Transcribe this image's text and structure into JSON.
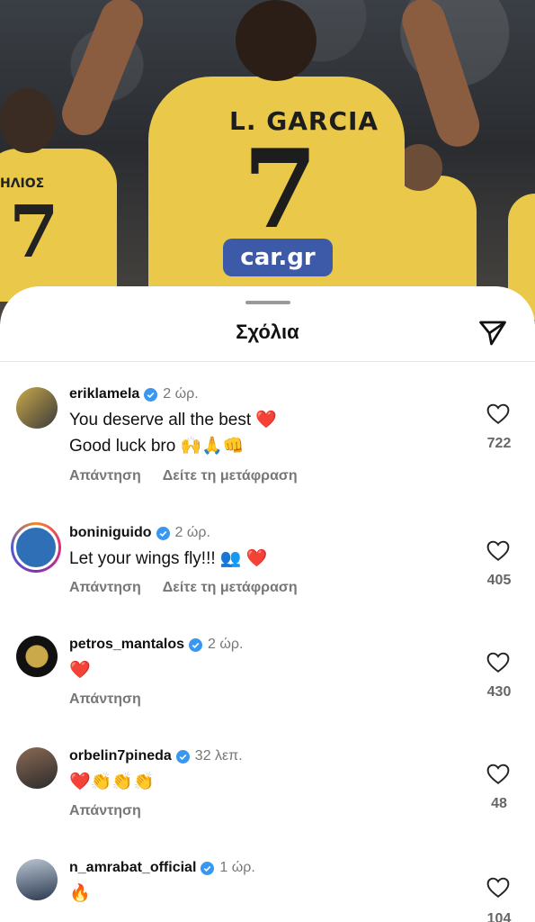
{
  "photo": {
    "shirt_name": "L. GARCIA",
    "shirt_number": "7",
    "left_shirt_name": "ΗΛΙΟΣ",
    "left_shirt_number": "7",
    "sponsor": "car.gr"
  },
  "sheet": {
    "title": "Σχόλια"
  },
  "colors": {
    "verified": "#3897f0",
    "heart": "#ed4956",
    "muted": "#777777"
  },
  "comments": [
    {
      "username": "eriklamela",
      "time": "2 ώρ.",
      "lines": [
        "You deserve all the best ❤️",
        "Good luck bro 🙌🙏👊"
      ],
      "reply_label": "Απάντηση",
      "translate_label": "Δείτε τη μετάφραση",
      "likes": "722"
    },
    {
      "username": "boniniguido",
      "time": "2 ώρ.",
      "lines": [
        "Let your wings fly!!! 👥 ❤️"
      ],
      "reply_label": "Απάντηση",
      "translate_label": "Δείτε τη μετάφραση",
      "likes": "405"
    },
    {
      "username": "petros_mantalos",
      "time": "2 ώρ.",
      "lines": [
        "❤️"
      ],
      "reply_label": "Απάντηση",
      "likes": "430"
    },
    {
      "username": "orbelin7pineda",
      "time": "32 λεπ.",
      "lines": [
        "❤️👏👏👏"
      ],
      "reply_label": "Απάντηση",
      "likes": "48"
    },
    {
      "username": "n_amrabat_official",
      "time": "1 ώρ.",
      "lines": [
        "🔥"
      ],
      "likes": "104"
    }
  ]
}
